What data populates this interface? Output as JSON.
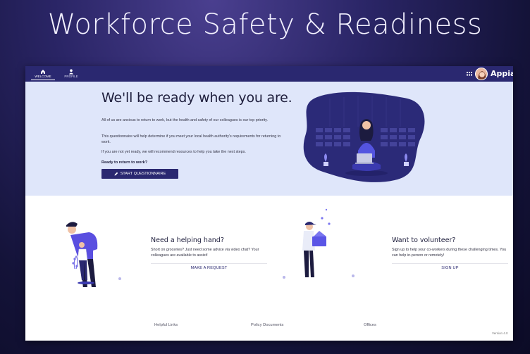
{
  "slide": {
    "title": "Workforce Safety & Readiness"
  },
  "topbar": {
    "tabs": [
      {
        "label": "WELCOME",
        "icon": "home-icon",
        "active": true
      },
      {
        "label": "PROFILE",
        "icon": "user-icon",
        "active": false
      }
    ],
    "brand": "Appian",
    "colors": {
      "bar": "#2a2870"
    }
  },
  "hero": {
    "title": "We'll be ready when you are.",
    "paragraphs": [
      "All of us are anxious to return to work, but the health and safety of our colleagues is our top priority.",
      "This questionnaire will help determine if you meet your local health authority's requirements for returning to work.",
      "If you are not yet ready, we will recommend resources to help you take the next steps."
    ],
    "ready_label": "Ready to return to work?",
    "start_button": "START QUESTIONNAIRE",
    "colors": {
      "background": "#dfe6fa",
      "accent": "#2a2870"
    }
  },
  "cards": [
    {
      "title": "Need a helping hand?",
      "text": "Short on groceries? Just need some advice via video chat? Your colleagues are available to assist!",
      "link": "MAKE A REQUEST"
    },
    {
      "title": "Want to volunteer?",
      "text": "Sign up to help your co-workers during these challenging times. You can help in-person or remotely!",
      "link": "SIGN UP"
    }
  ],
  "footer": {
    "links": [
      "Helpful Links",
      "Policy Documents",
      "Offices"
    ],
    "version": "Version 4.0"
  }
}
